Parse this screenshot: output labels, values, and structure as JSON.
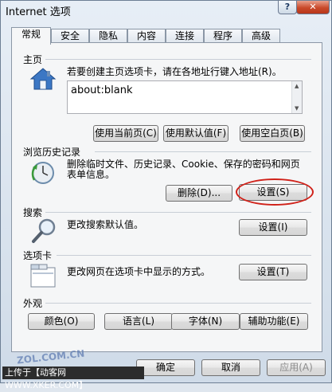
{
  "window": {
    "title": "Internet 选项",
    "help": "?",
    "close": "✕"
  },
  "tabs": [
    "常规",
    "安全",
    "隐私",
    "内容",
    "连接",
    "程序",
    "高级"
  ],
  "home": {
    "label": "主页",
    "description": "若要创建主页选项卡，请在各地址行键入地址(R)。",
    "address": "about:blank",
    "btn_current": "使用当前页(C)",
    "btn_default": "使用默认值(F)",
    "btn_blank": "使用空白页(B)"
  },
  "history": {
    "label": "浏览历史记录",
    "description_1": "删除临时文件、历史记录、Cookie、保存的密码和网页",
    "description_2": "表单信息。",
    "btn_delete": "删除(D)...",
    "btn_settings": "设置(S)"
  },
  "search": {
    "label": "搜索",
    "description": "更改搜索默认值。",
    "btn_settings": "设置(I)"
  },
  "tabs_section": {
    "label": "选项卡",
    "description": "更改网页在选项卡中显示的方式。",
    "btn_settings": "设置(T)"
  },
  "appearance": {
    "label": "外观",
    "btn_colors": "颜色(O)",
    "btn_languages": "语言(L)",
    "btn_fonts": "字体(N)",
    "btn_accessibility": "辅助功能(E)"
  },
  "footer": {
    "ok": "确定",
    "cancel": "取消",
    "apply": "应用(A)"
  },
  "watermark": {
    "url": "上传于【动客网 WWW.XKER.COM】",
    "site": "ZOL.COM.CN"
  }
}
